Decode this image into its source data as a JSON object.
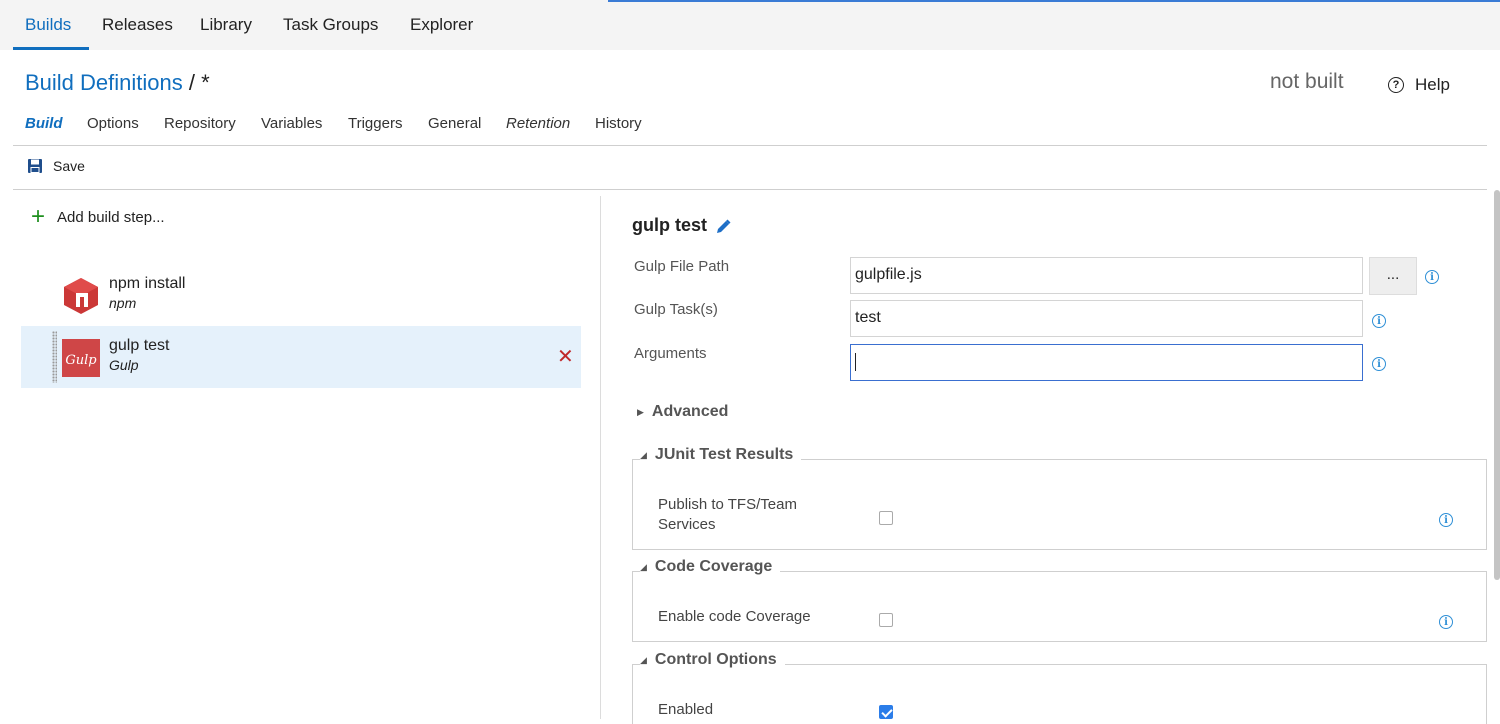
{
  "topnav": {
    "tabs": [
      {
        "label": "Builds",
        "active": true
      },
      {
        "label": "Releases"
      },
      {
        "label": "Library"
      },
      {
        "label": "Task Groups"
      },
      {
        "label": "Explorer"
      }
    ]
  },
  "header": {
    "breadcrumb_link": "Build Definitions",
    "breadcrumb_rest": "/ *",
    "status": "not built",
    "help_label": "Help"
  },
  "subtabs": [
    {
      "label": "Build",
      "active": true
    },
    {
      "label": "Options"
    },
    {
      "label": "Repository"
    },
    {
      "label": "Variables"
    },
    {
      "label": "Triggers"
    },
    {
      "label": "General"
    },
    {
      "label": "Retention",
      "italic": true
    },
    {
      "label": "History"
    }
  ],
  "toolbar": {
    "save_label": "Save"
  },
  "steps_panel": {
    "add_label": "Add build step...",
    "steps": [
      {
        "name": "npm install",
        "kind": "npm",
        "icon": "npm-icon"
      },
      {
        "name": "gulp test",
        "kind": "Gulp",
        "icon": "gulp-icon",
        "selected": true
      }
    ],
    "gulp_logo_text": "Gulp"
  },
  "details": {
    "title": "gulp test",
    "fields": {
      "gulp_file_label": "Gulp File Path",
      "gulp_file_value": "gulpfile.js",
      "browse_label": "...",
      "tasks_label": "Gulp Task(s)",
      "tasks_value": "test",
      "arguments_label": "Arguments",
      "arguments_value": ""
    },
    "advanced_label": "Advanced",
    "junit": {
      "title": "JUnit Test Results",
      "publish_label_line1": "Publish to TFS/Team",
      "publish_label_line2": "Services",
      "publish_checked": false
    },
    "coverage": {
      "title": "Code Coverage",
      "enable_label": "Enable code Coverage",
      "enable_checked": false
    },
    "control": {
      "title": "Control Options",
      "enabled_label": "Enabled",
      "enabled_checked": true
    }
  },
  "colors": {
    "accent": "#106ebe",
    "delete": "#c0282a",
    "info": "#2e8fd6",
    "npm": "#cb3837",
    "gulp": "#cf4647"
  }
}
